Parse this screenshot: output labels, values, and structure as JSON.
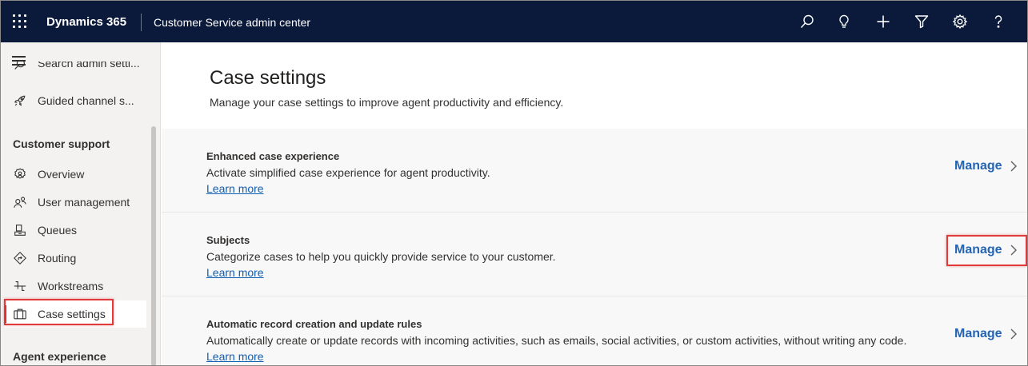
{
  "topbar": {
    "brand": "Dynamics 365",
    "app_name": "Customer Service admin center",
    "icons": [
      "search-icon",
      "lightbulb-icon",
      "plus-icon",
      "filter-icon",
      "gear-icon",
      "help-icon"
    ],
    "background": "#0b1a3a"
  },
  "sidebar": {
    "clipped_item": {
      "label": "Search admin setti...",
      "icon": "search-icon"
    },
    "top_items": [
      {
        "label": "Guided channel s...",
        "icon": "rocket-icon"
      }
    ],
    "section_customer_support": "Customer support",
    "items": [
      {
        "label": "Overview",
        "icon": "overview-icon"
      },
      {
        "label": "User management",
        "icon": "users-icon"
      },
      {
        "label": "Queues",
        "icon": "queue-icon"
      },
      {
        "label": "Routing",
        "icon": "routing-icon"
      },
      {
        "label": "Workstreams",
        "icon": "workstream-icon"
      },
      {
        "label": "Case settings",
        "icon": "briefcase-icon",
        "active": true
      }
    ],
    "section_agent_experience": "Agent experience"
  },
  "main": {
    "title": "Case settings",
    "subtitle": "Manage your case settings to improve agent productivity and efficiency.",
    "cards": [
      {
        "title": "Enhanced case experience",
        "description": "Activate simplified case experience for agent productivity.",
        "link": "Learn more",
        "action": "Manage"
      },
      {
        "title": "Subjects",
        "description": "Categorize cases to help you quickly provide service to your customer.",
        "link": "Learn more",
        "action": "Manage",
        "highlighted": true
      },
      {
        "title": "Automatic record creation and update rules",
        "description": "Automatically create or update records with incoming activities, such as emails, social activities, or custom activities, without writing any code.",
        "link": "Learn more",
        "action": "Manage"
      }
    ]
  },
  "colors": {
    "accent": "#2464b4",
    "link": "#0f5fb3",
    "highlight": "#e03a3a"
  }
}
